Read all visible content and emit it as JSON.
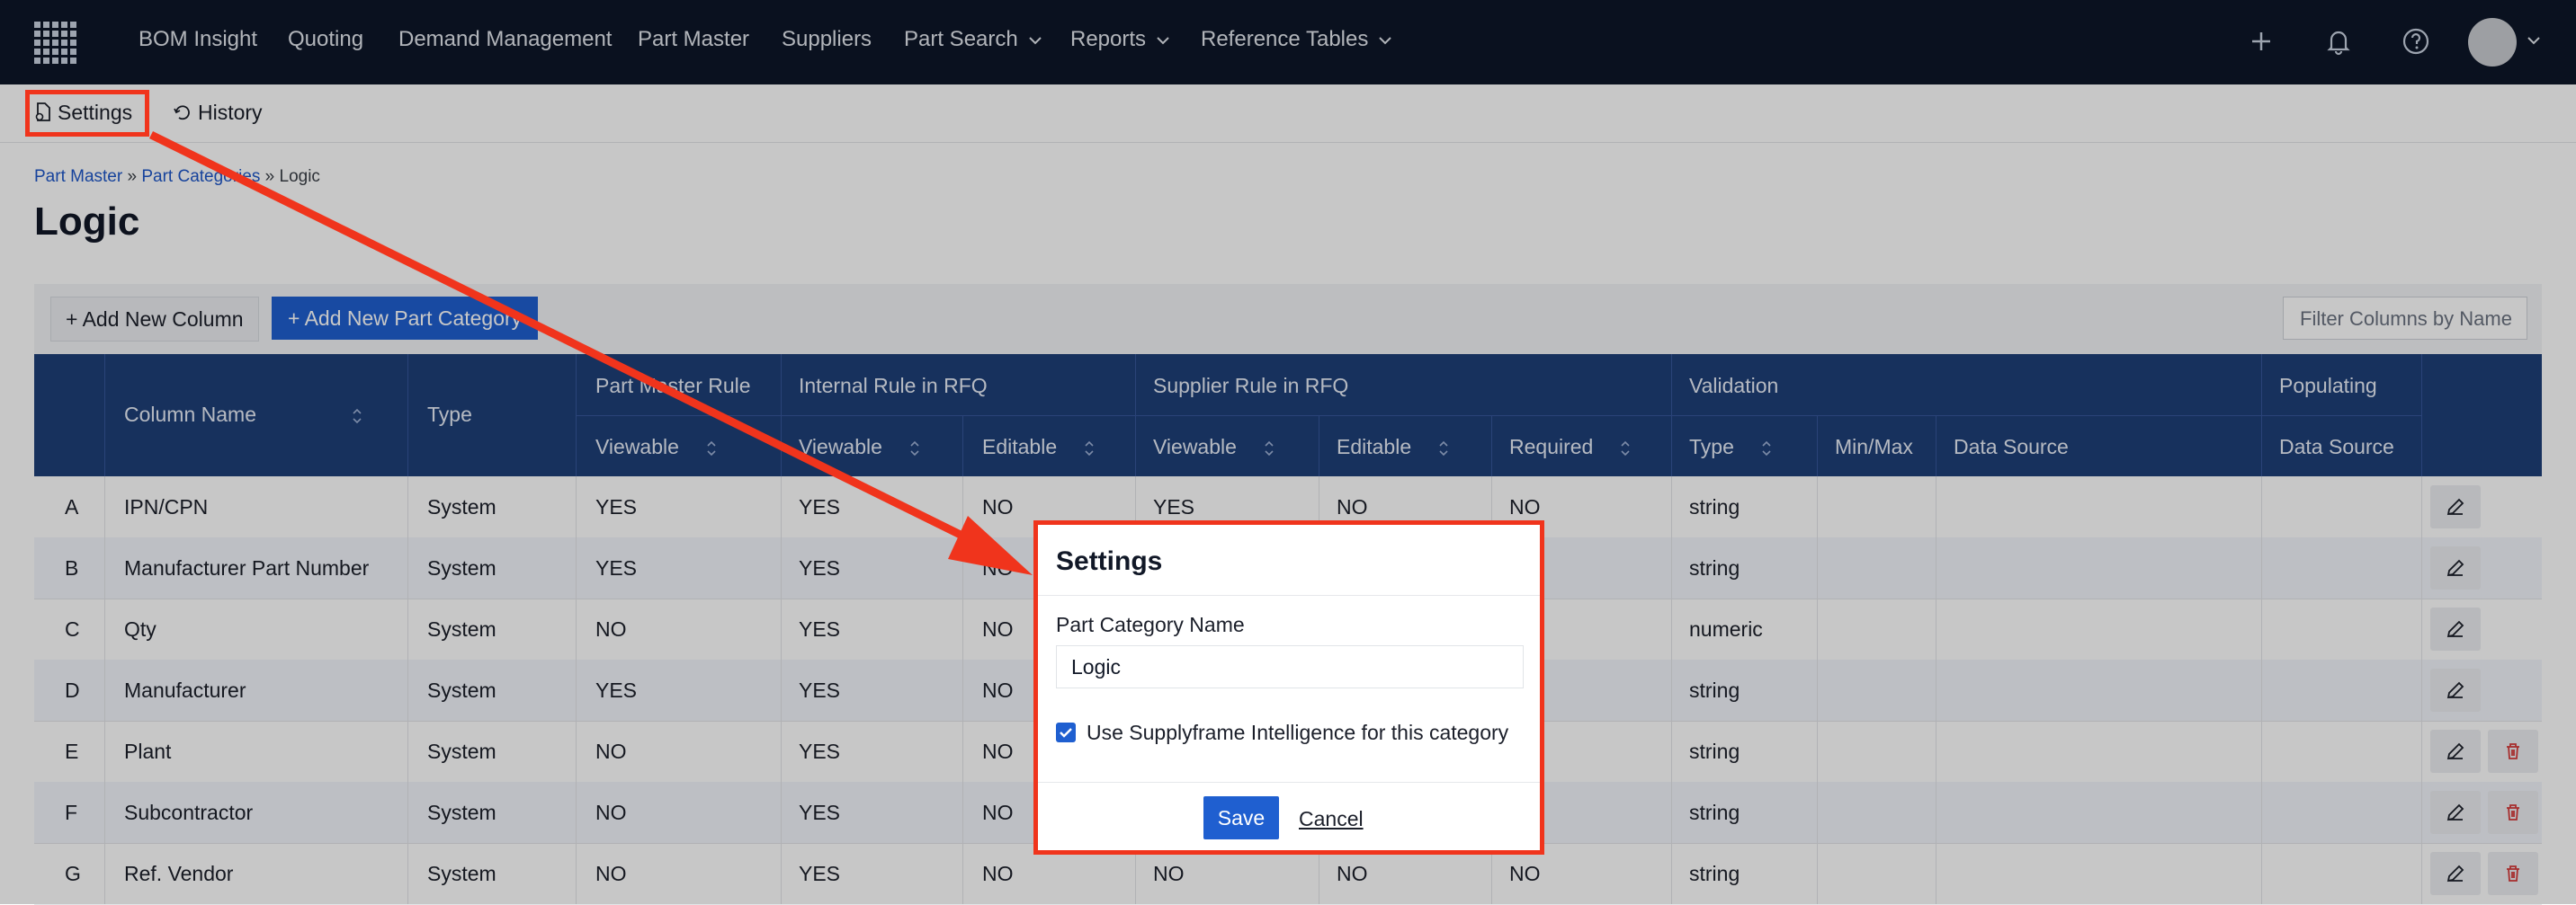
{
  "nav": {
    "items": [
      "BOM Insight",
      "Quoting",
      "Demand Management",
      "Part Master",
      "Suppliers"
    ],
    "dropdowns": [
      "Part Search",
      "Reports",
      "Reference Tables"
    ],
    "icons": [
      "plus-icon",
      "bell-icon",
      "help-icon",
      "avatar"
    ]
  },
  "subnav": {
    "settings": "Settings",
    "history": "History"
  },
  "breadcrumb": {
    "part_master": "Part Master",
    "sep1": "»",
    "part_categories": "Part Categories",
    "sep2": "»",
    "current": "Logic"
  },
  "page": {
    "title": "Logic"
  },
  "toolbar": {
    "add_column_label": "Add New Column",
    "add_category_label": "Add New Part Category",
    "filter_placeholder": "Filter Columns by Name"
  },
  "table": {
    "headers": {
      "column_name": "Column Name",
      "type": "Type",
      "part_master_rule": "Part Master Rule",
      "internal_rule": "Internal Rule in RFQ",
      "supplier_rule": "Supplier Rule in RFQ",
      "validation": "Validation",
      "populating": "Populating",
      "viewable": "Viewable",
      "editable": "Editable",
      "required": "Required",
      "val_type": "Type",
      "min_max": "Min/Max",
      "data_source": "Data Source"
    },
    "rows": [
      {
        "letter": "A",
        "name": "IPN/CPN",
        "type": "System",
        "pm_view": "YES",
        "int_view": "YES",
        "int_edit": "NO",
        "sup_view": "YES",
        "sup_edit": "NO",
        "required": "NO",
        "val_type": "string"
      },
      {
        "letter": "B",
        "name": "Manufacturer Part Number",
        "type": "System",
        "pm_view": "YES",
        "int_view": "YES",
        "int_edit": "NO",
        "sup_view": "",
        "sup_edit": "",
        "required": "",
        "val_type": "string"
      },
      {
        "letter": "C",
        "name": "Qty",
        "type": "System",
        "pm_view": "NO",
        "int_view": "YES",
        "int_edit": "NO",
        "sup_view": "",
        "sup_edit": "",
        "required": "",
        "val_type": "numeric"
      },
      {
        "letter": "D",
        "name": "Manufacturer",
        "type": "System",
        "pm_view": "YES",
        "int_view": "YES",
        "int_edit": "NO",
        "sup_view": "",
        "sup_edit": "",
        "required": "",
        "val_type": "string"
      },
      {
        "letter": "E",
        "name": "Plant",
        "type": "System",
        "pm_view": "NO",
        "int_view": "YES",
        "int_edit": "NO",
        "sup_view": "",
        "sup_edit": "",
        "required": "",
        "val_type": "string"
      },
      {
        "letter": "F",
        "name": "Subcontractor",
        "type": "System",
        "pm_view": "NO",
        "int_view": "YES",
        "int_edit": "NO",
        "sup_view": "",
        "sup_edit": "",
        "required": "",
        "val_type": "string"
      },
      {
        "letter": "G",
        "name": "Ref. Vendor",
        "type": "System",
        "pm_view": "NO",
        "int_view": "YES",
        "int_edit": "NO",
        "sup_view": "NO",
        "sup_edit": "NO",
        "required": "NO",
        "val_type": "string"
      }
    ]
  },
  "modal": {
    "title": "Settings",
    "name_label": "Part Category Name",
    "name_value": "Logic",
    "checkbox_label": "Use Supplyframe Intelligence for this category",
    "checkbox_checked": true,
    "save_label": "Save",
    "cancel_label": "Cancel"
  },
  "annotation": {
    "color": "#f0341c"
  },
  "colors": {
    "nav_bg": "#0d1628",
    "table_header": "#1e3f78",
    "primary": "#1f5fd0",
    "danger": "#d63a3a"
  }
}
